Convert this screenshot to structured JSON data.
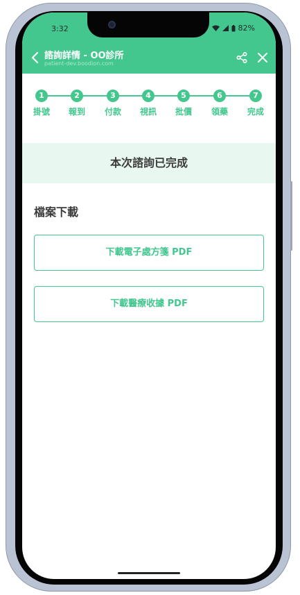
{
  "status_bar": {
    "time": "3:32",
    "battery": "82%"
  },
  "app_bar": {
    "title": "諮詢詳情 - OO診所",
    "subtitle": "patient-dev.boodion.com"
  },
  "steps": [
    {
      "number": "1",
      "label": "掛號"
    },
    {
      "number": "2",
      "label": "報到"
    },
    {
      "number": "3",
      "label": "付款"
    },
    {
      "number": "4",
      "label": "視訊"
    },
    {
      "number": "5",
      "label": "批價"
    },
    {
      "number": "6",
      "label": "領藥"
    },
    {
      "number": "7",
      "label": "完成"
    }
  ],
  "banner": {
    "text": "本次諮詢已完成"
  },
  "downloads": {
    "title": "檔案下載",
    "prescription_label": "下載電子處方箋 PDF",
    "receipt_label": "下載醫療收據 PDF"
  },
  "colors": {
    "accent": "#43c78f",
    "banner_bg": "#e8f8f0"
  }
}
